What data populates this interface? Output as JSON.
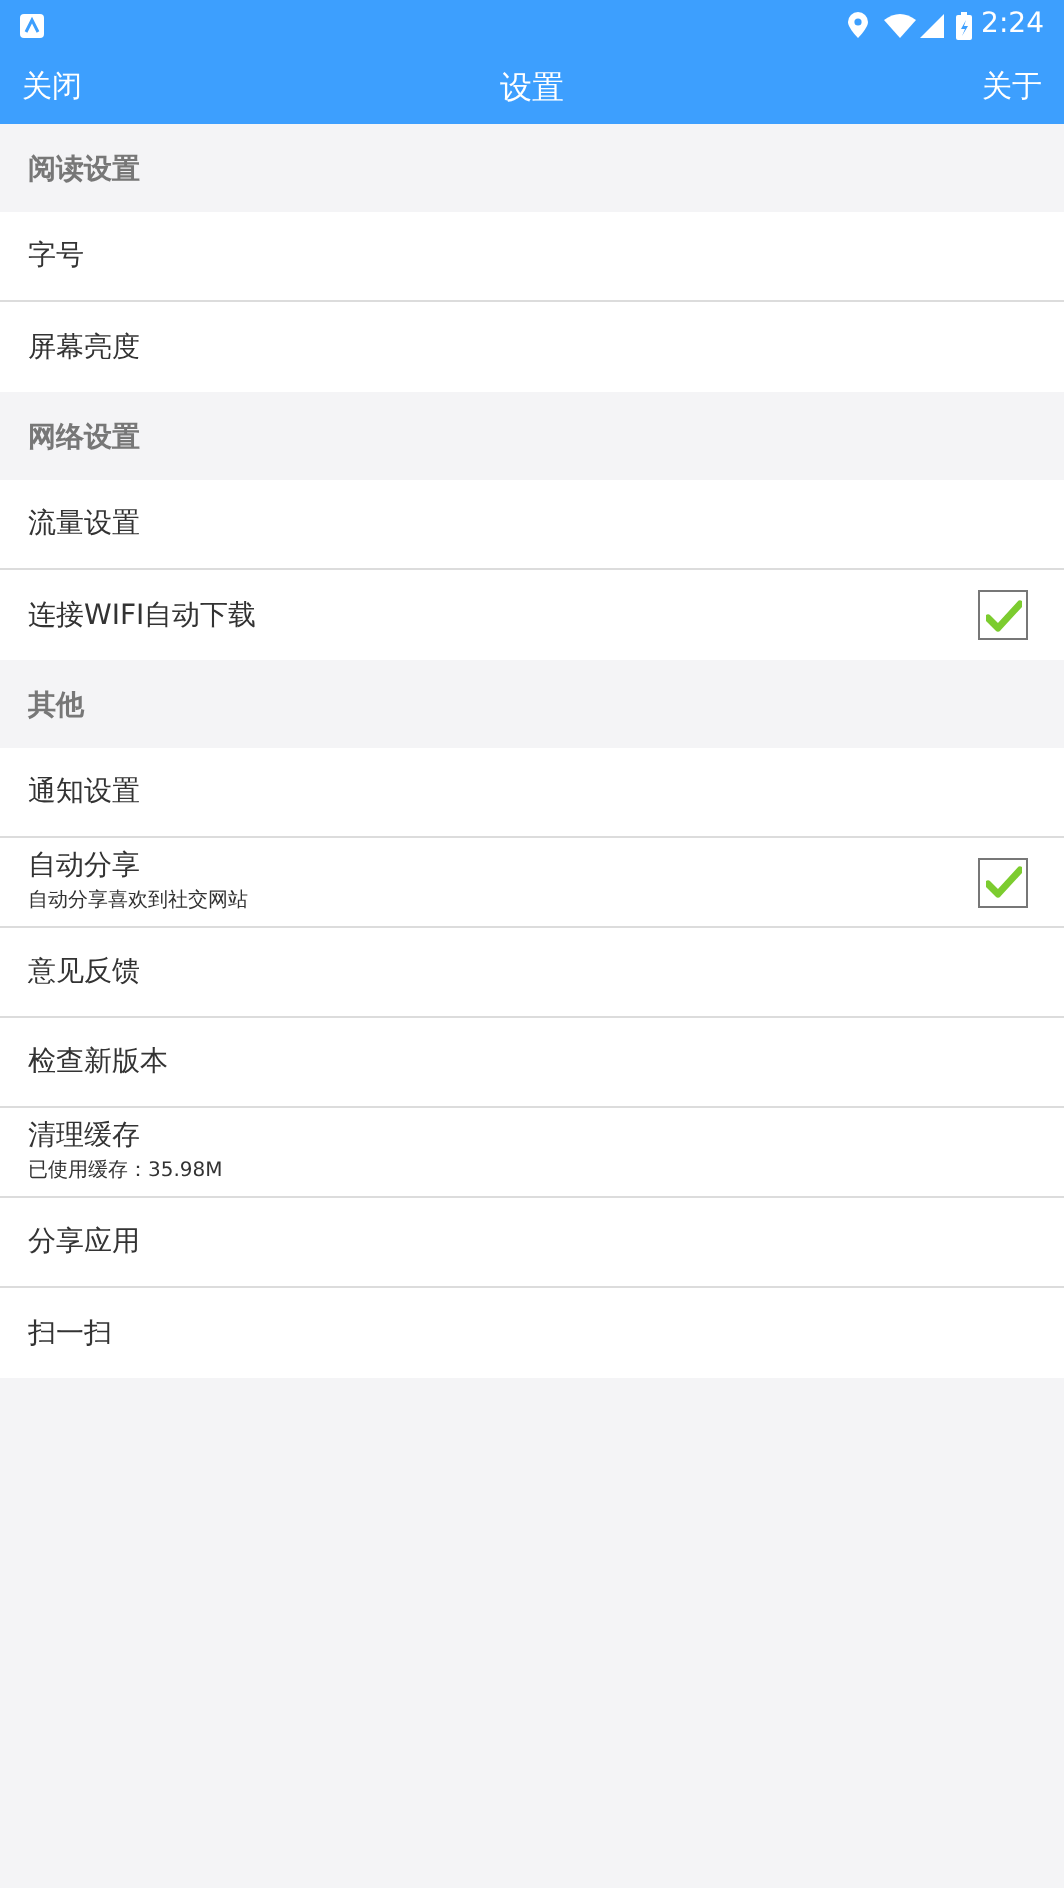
{
  "status_bar": {
    "time": "2:24"
  },
  "nav_bar": {
    "left": "关闭",
    "title": "设置",
    "right": "关于"
  },
  "sections": [
    {
      "title": "阅读设置",
      "items": [
        {
          "kind": "plain",
          "label": "字号"
        },
        {
          "kind": "plain",
          "label": "屏幕亮度"
        }
      ]
    },
    {
      "title": "网络设置",
      "items": [
        {
          "kind": "plain",
          "label": "流量设置"
        },
        {
          "kind": "checkbox",
          "label": "连接WIFI自动下载",
          "checked": true
        }
      ]
    },
    {
      "title": "其他",
      "items": [
        {
          "kind": "plain",
          "label": "通知设置"
        },
        {
          "kind": "checkbox",
          "label": "自动分享",
          "subtitle": "自动分享喜欢到社交网站",
          "checked": true
        },
        {
          "kind": "plain",
          "label": "意见反馈"
        },
        {
          "kind": "plain",
          "label": "检查新版本"
        },
        {
          "kind": "plain",
          "label": "清理缓存",
          "subtitle": "已使用缓存：35.98M"
        },
        {
          "kind": "plain",
          "label": "分享应用"
        },
        {
          "kind": "plain",
          "label": "扫一扫"
        }
      ]
    }
  ]
}
